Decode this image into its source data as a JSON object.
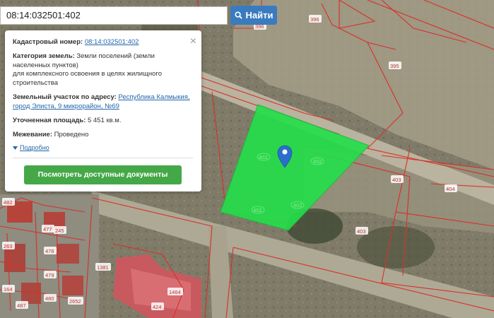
{
  "search": {
    "value": "08:14:032501:402",
    "button_label": "Найти"
  },
  "popup": {
    "cadastral_label": "Кадастровый номер:",
    "cadastral_value": "08:14:032501:402",
    "category_label": "Категория земель:",
    "category_line1": "Земли поселений (земли",
    "category_line2": "населенных пунктов)",
    "category_line3": "для комплексного освоения в целях жилищного",
    "category_line4": "строительства",
    "address_label": "Земельный участок по адресу:",
    "address_link_line1": "Республика Калмыкия,",
    "address_link_line2": "город Элиста, 9 микрорайон, №69",
    "area_label": "Уточненная площадь:",
    "area_value": "5 451 кв.м.",
    "survey_label": "Межевание:",
    "survey_value": "Проведено",
    "more_label": "Подробно",
    "docs_button_label": "Посмотреть доступные документы"
  },
  "map": {
    "parcel_color": "#22e04a",
    "marker_color": "#2a6fc9",
    "parcel_labels": [
      "402",
      "402",
      "402",
      "402"
    ],
    "plot_labels": [
      "396",
      "396",
      "395",
      "403",
      "404",
      "403",
      "1381",
      "1464",
      "424",
      "477",
      "478",
      "479",
      "480",
      "263",
      "487",
      "482",
      "164",
      "2652",
      "245"
    ]
  }
}
